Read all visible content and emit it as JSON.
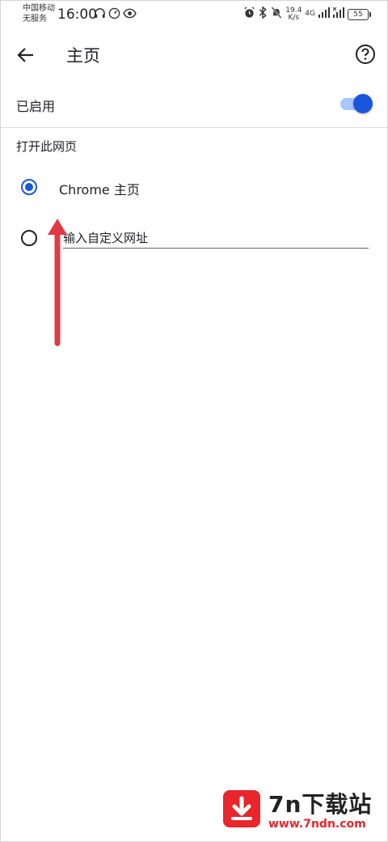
{
  "status_bar": {
    "carrier_line1": "中国移动",
    "carrier_line2": "无服务",
    "time": "16:00",
    "net_speed_value": "19.4",
    "net_speed_unit": "K/s",
    "network_type": "4G",
    "battery": "55"
  },
  "toolbar": {
    "title": "主页"
  },
  "settings": {
    "enabled_label": "已启用",
    "enabled": true,
    "section_header": "打开此网页",
    "options": [
      {
        "label": "Chrome 主页",
        "selected": true
      },
      {
        "label": "输入自定义网址",
        "selected": false
      }
    ],
    "custom_url_placeholder": "输入自定义网址",
    "accent_color": "#1a56db"
  },
  "annotation": {
    "arrow_color": "#e03a45"
  },
  "watermark": {
    "title": "7n下载站",
    "url": "www.7ndn.com"
  }
}
